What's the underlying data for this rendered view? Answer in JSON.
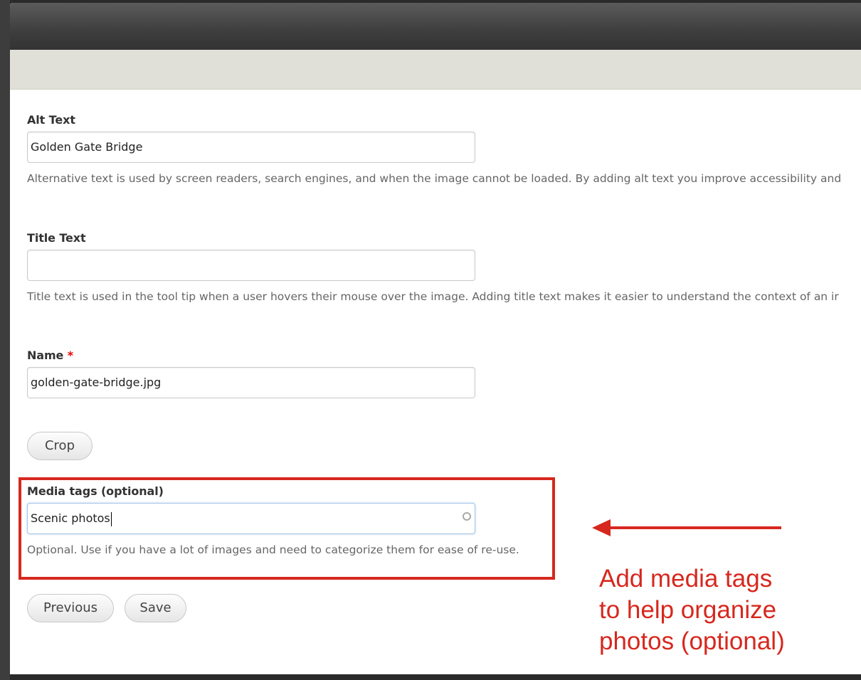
{
  "form": {
    "alt_text": {
      "label": "Alt Text",
      "value": "Golden Gate Bridge",
      "help": "Alternative text is used by screen readers, search engines, and when the image cannot be loaded. By adding alt text you improve accessibility and"
    },
    "title_text": {
      "label": "Title Text",
      "value": "",
      "help": "Title text is used in the tool tip when a user hovers their mouse over the image. Adding title text makes it easier to understand the context of an ir"
    },
    "name": {
      "label": "Name",
      "required_marker": "*",
      "value": "golden-gate-bridge.jpg"
    },
    "crop_button": "Crop",
    "media_tags": {
      "label": "Media tags (optional)",
      "value": "Scenic photos",
      "help": "Optional. Use if you have a lot of images and need to categorize them for ease of re-use."
    },
    "previous_button": "Previous",
    "save_button": "Save"
  },
  "annotation": {
    "lines": [
      "Add media tags",
      "to help organize",
      "photos (optional)"
    ],
    "color": "#d6281e"
  }
}
